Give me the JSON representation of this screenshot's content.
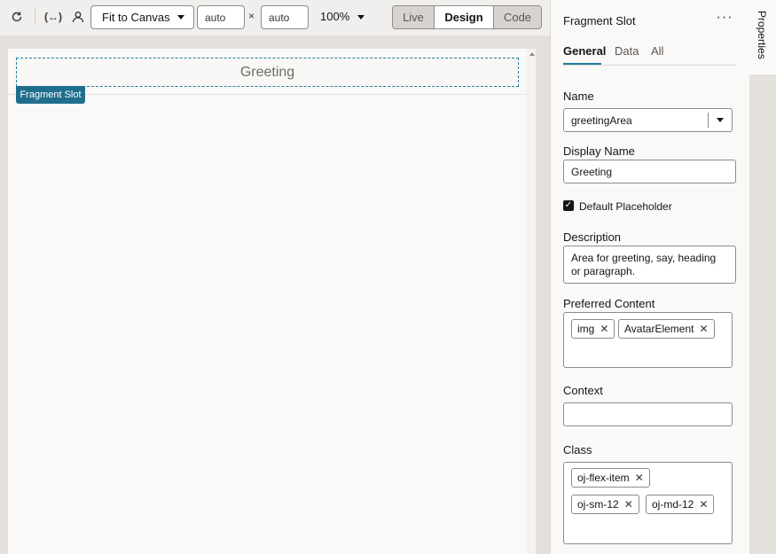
{
  "toolbar": {
    "fit_select": "Fit to Canvas",
    "width_value": "auto",
    "height_value": "auto",
    "times_glyph": "×",
    "zoom": "100%",
    "modes": {
      "live": "Live",
      "design": "Design",
      "code": "Code"
    },
    "icons": [
      "refresh-icon",
      "variable-icon",
      "user-icon"
    ]
  },
  "canvas": {
    "slot_text": "Greeting",
    "slot_badge": "Fragment Slot"
  },
  "panel": {
    "title": "Fragment Slot",
    "more_glyph": "···",
    "tabs": [
      "General",
      "Data",
      "All"
    ],
    "name_label": "Name",
    "name_value": "greetingArea",
    "display_name_label": "Display Name",
    "display_name_value": "Greeting",
    "default_placeholder_label": "Default Placeholder",
    "default_placeholder_checked": true,
    "description_label": "Description",
    "description_value": "Area for greeting, say, heading or paragraph.",
    "preferred_content_label": "Preferred Content",
    "preferred_content_chips": [
      "img",
      "AvatarElement"
    ],
    "context_label": "Context",
    "context_value": "",
    "class_label": "Class",
    "class_chips": [
      "oj-flex-item",
      "oj-sm-12",
      "oj-md-12"
    ]
  },
  "rail": {
    "properties_label": "Properties"
  },
  "colors": {
    "accent": "#227e9e",
    "badge": "#1f6e8b"
  }
}
